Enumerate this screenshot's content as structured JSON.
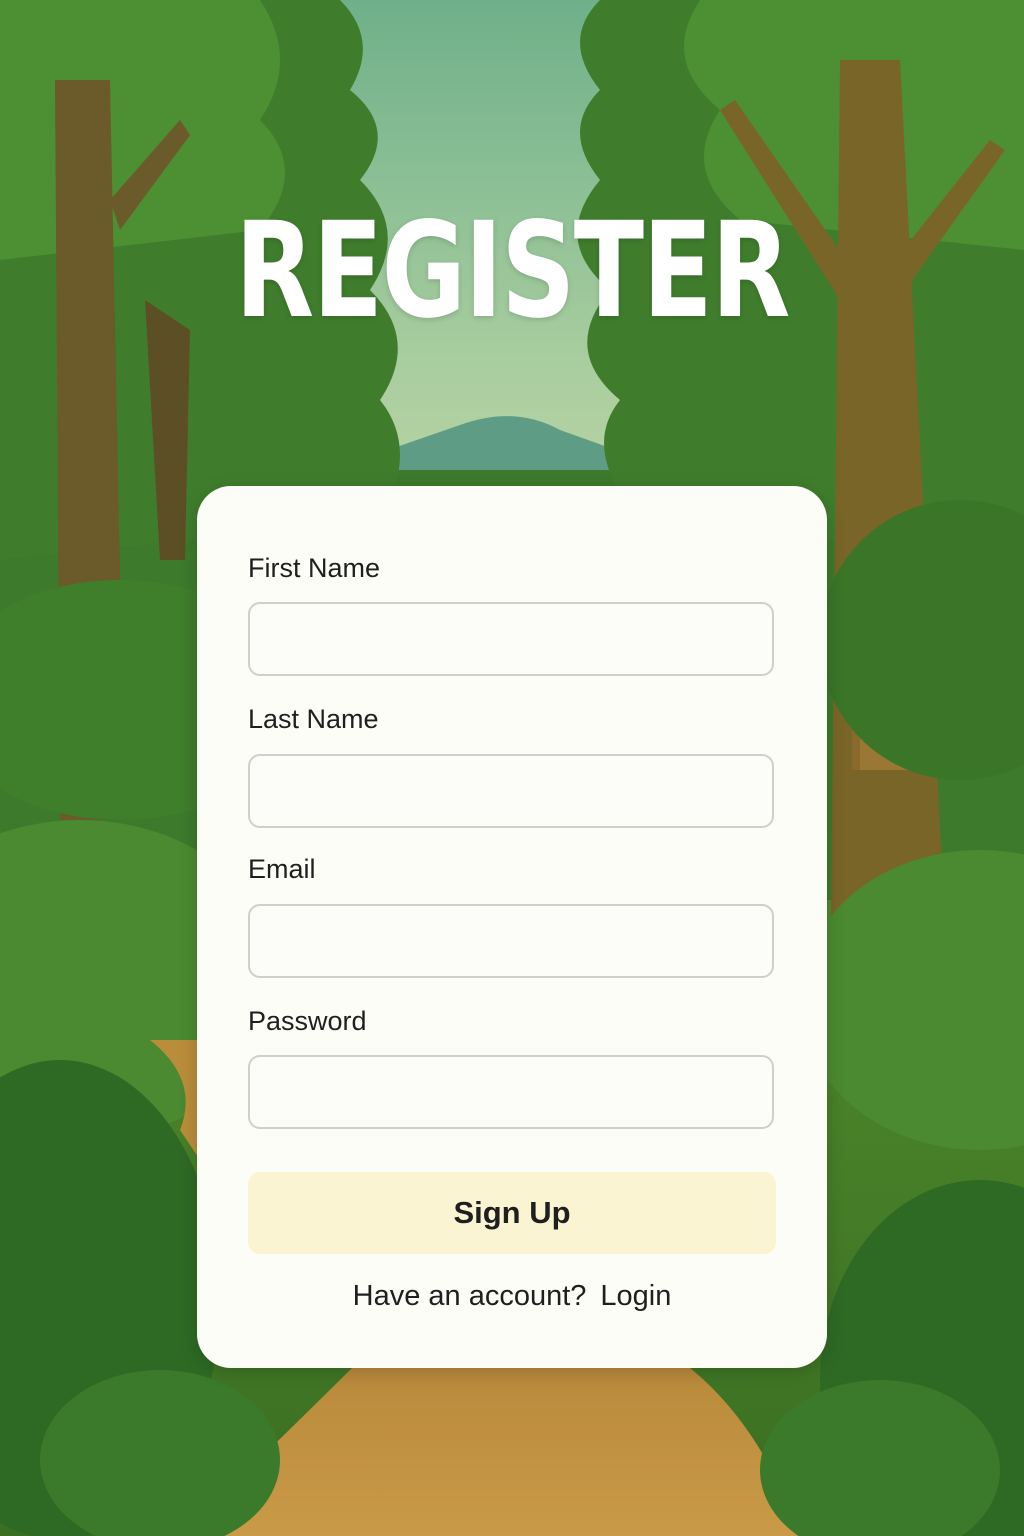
{
  "header": {
    "title": "REGISTER"
  },
  "form": {
    "fields": [
      {
        "label": "First Name",
        "value": "",
        "placeholder": ""
      },
      {
        "label": "Last Name",
        "value": "",
        "placeholder": ""
      },
      {
        "label": "Email",
        "value": "",
        "placeholder": ""
      },
      {
        "label": "Password",
        "value": "",
        "placeholder": ""
      }
    ],
    "submit_label": "Sign Up"
  },
  "footer": {
    "prompt": "Have an account?",
    "link_label": "Login"
  },
  "colors": {
    "card_background": "#fdfdf8",
    "button_background": "#fbf4d2",
    "title_color": "#ffffff",
    "forest_green": "#3f7a2e",
    "sky": "#8cbf9a",
    "path": "#b98d3a"
  }
}
